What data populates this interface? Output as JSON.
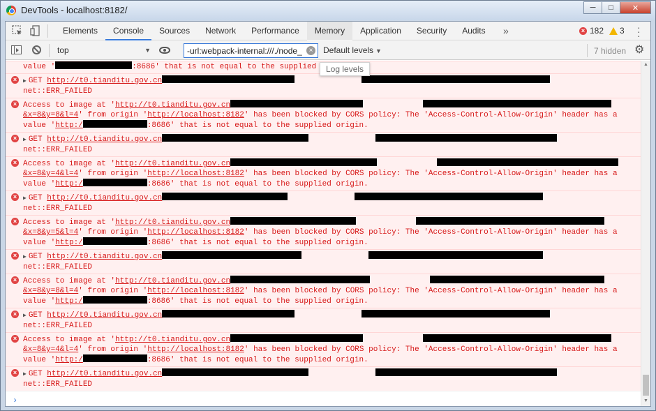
{
  "window": {
    "title": "DevTools - localhost:8182/",
    "minimize": "─",
    "maximize": "□",
    "close": "✕"
  },
  "tabs": [
    {
      "label": "Elements"
    },
    {
      "label": "Console"
    },
    {
      "label": "Sources"
    },
    {
      "label": "Network"
    },
    {
      "label": "Performance"
    },
    {
      "label": "Memory"
    },
    {
      "label": "Application"
    },
    {
      "label": "Security"
    },
    {
      "label": "Audits"
    }
  ],
  "more_tabs": "»",
  "counts": {
    "errors": "182",
    "warnings": "3"
  },
  "toolbar": {
    "context": "top",
    "filter_value": "-url:webpack-internal:///./node_",
    "levels": "Default levels",
    "hidden": "7 hidden",
    "tooltip": "Log levels"
  },
  "messages": [
    {
      "type": "cors-tail",
      "l1a": "value '",
      "l1b": ":8686' that is not equal to the supplied origin."
    },
    {
      "type": "get",
      "url": "http://t0.tianditu.gov.cn",
      "l2": "net::ERR_FAILED"
    },
    {
      "type": "cors",
      "pre": "Access to image at '",
      "url": "http://t0.tianditu.gov.cn",
      "params": "&x=8&y=8&l=4",
      "from": "' from origin '",
      "origin": "http://localhost:8182",
      "blocked": "' has been blocked by CORS policy: The 'Access-Control-Allow-Origin' header has a",
      "v1": "value '",
      "v2": ":8686' that is not equal to the supplied origin."
    },
    {
      "type": "get",
      "url": "http://t0.tianditu.gov.cn",
      "l2": "net::ERR_FAILED"
    },
    {
      "type": "cors",
      "pre": "Access to image at '",
      "url": "http://t0.tianditu.gov.cn",
      "params": "&x=8&y=4&l=4",
      "from": "' from origin '",
      "origin": "http://localhost:8182",
      "blocked": "' has been blocked by CORS policy: The 'Access-Control-Allow-Origin' header has a",
      "v1": "value '",
      "v2": ":8686' that is not equal to the supplied origin."
    },
    {
      "type": "get",
      "url": "http://t0.tianditu.gov.cn",
      "l2": "net::ERR_FAILED"
    },
    {
      "type": "cors",
      "pre": "Access to image at '",
      "url": "http://t0.tianditu.gov.cn",
      "params": "&x=8&y=5&l=4",
      "from": "' from origin '",
      "origin": "http://localhost:8182",
      "blocked": "' has been blocked by CORS policy: The 'Access-Control-Allow-Origin' header has a",
      "v1": "value '",
      "v2": ":8686' that is not equal to the supplied origin."
    },
    {
      "type": "get",
      "url": "http://t0.tianditu.gov.cn",
      "l2": "net::ERR_FAILED"
    },
    {
      "type": "cors",
      "pre": "Access to image at '",
      "url": "http://t0.tianditu.gov.cn",
      "params": "&x=8&y=8&l=4",
      "from": "' from origin '",
      "origin": "http://localhost:8182",
      "blocked": "' has been blocked by CORS policy: The 'Access-Control-Allow-Origin' header has a",
      "v1": "value '",
      "v2": ":8686' that is not equal to the supplied origin."
    },
    {
      "type": "get",
      "url": "http://t0.tianditu.gov.cn",
      "l2": "net::ERR_FAILED"
    },
    {
      "type": "cors",
      "pre": "Access to image at '",
      "url": "http://t0.tianditu.gov.cn",
      "params": "&x=8&y=4&l=4",
      "from": "' from origin '",
      "origin": "http://localhost:8182",
      "blocked": "' has been blocked by CORS policy: The 'Access-Control-Allow-Origin' header has a",
      "v1": "value '",
      "v2": ":8686' that is not equal to the supplied origin."
    },
    {
      "type": "get",
      "url": "http://t0.tianditu.gov.cn",
      "l2": "net::ERR_FAILED"
    }
  ],
  "get_prefix": "GET ",
  "prompt_caret": "›",
  "colors": {
    "error": "#d71a1a",
    "error_bg": "#fff0f0",
    "accent": "#3879d9"
  }
}
